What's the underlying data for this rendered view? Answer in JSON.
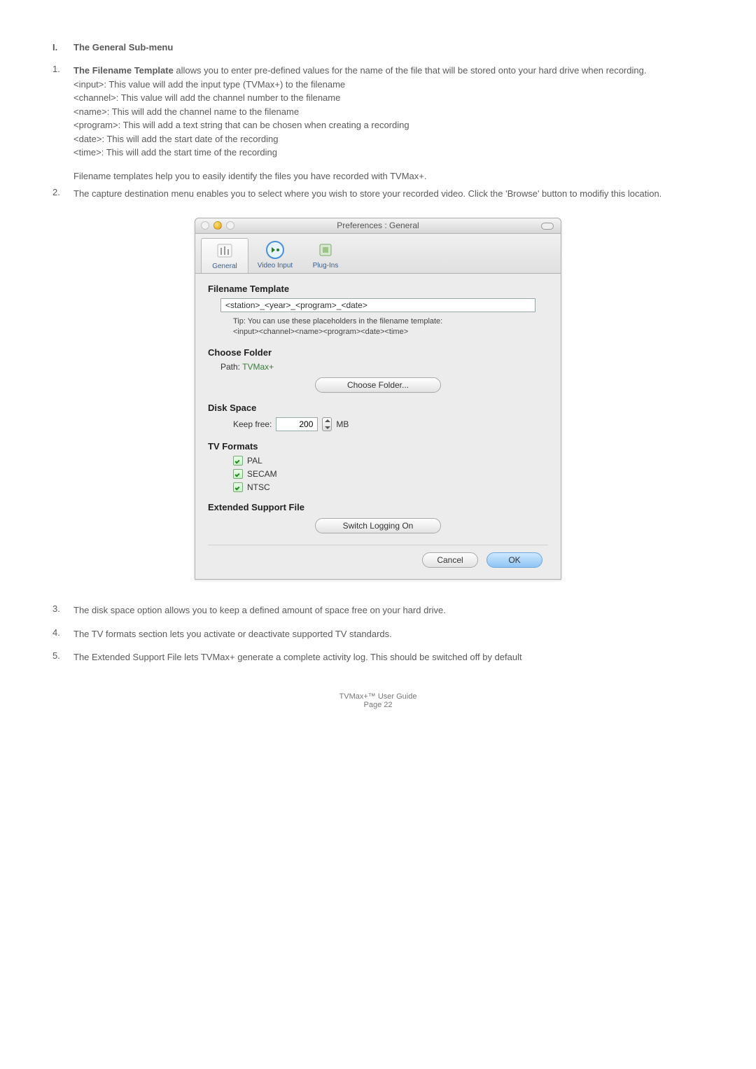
{
  "doc": {
    "section_num": "I.",
    "section_title": "The General Sub-menu",
    "item1_lead": "The Filename Template",
    "item1_rest": " allows you to enter pre-defined values for the name of the file that will be stored onto your hard drive when recording.",
    "item1_lines": [
      "<input>: This value will add the input type (TVMax+) to the filename",
      "<channel>: This value will add the channel number to the filename",
      "<name>: This will add the channel name to the filename",
      "<program>: This will add a text string that can be chosen when creating a recording",
      "<date>: This will add the start date of the recording",
      "<time>: This will add the start time of the recording"
    ],
    "item1_tail": "Filename templates help you to easily identify the files you have recorded with TVMax+.",
    "item2": "The capture destination menu enables you to select where you wish to store your recorded video. Click the 'Browse' button to modifiy this location.",
    "item3": "The disk space option allows you to keep a defined amount of space free on your hard drive.",
    "item4": "The TV formats section lets you activate or deactivate supported TV standards.",
    "item5": "The Extended Support File lets TVMax+ generate a complete activity log. This should be switched off by default",
    "footer1": "TVMax+™ User Guide",
    "footer2": "Page 22"
  },
  "win": {
    "title": "Preferences : General",
    "tabs": {
      "general": "General",
      "video": "Video Input",
      "plugins": "Plug-Ins"
    },
    "sec_filename": "Filename Template",
    "template_value": "<station>_<year>_<program>_<date>",
    "tip1": "Tip: You can use these placeholders in the filename template:",
    "tip2": "<input><channel><name><program><date><time>",
    "sec_choose": "Choose Folder",
    "path_label": "Path:  ",
    "path_value": "TVMax+",
    "choose_btn": "Choose Folder...",
    "sec_disk": "Disk Space",
    "keepfree_label": "Keep free:",
    "keepfree_value": "200",
    "mb": "MB",
    "sec_tv": "TV Formats",
    "pal": "PAL",
    "secam": "SECAM",
    "ntsc": "NTSC",
    "sec_ext": "Extended Support File",
    "logging_btn": "Switch Logging On",
    "cancel": "Cancel",
    "ok": "OK"
  }
}
